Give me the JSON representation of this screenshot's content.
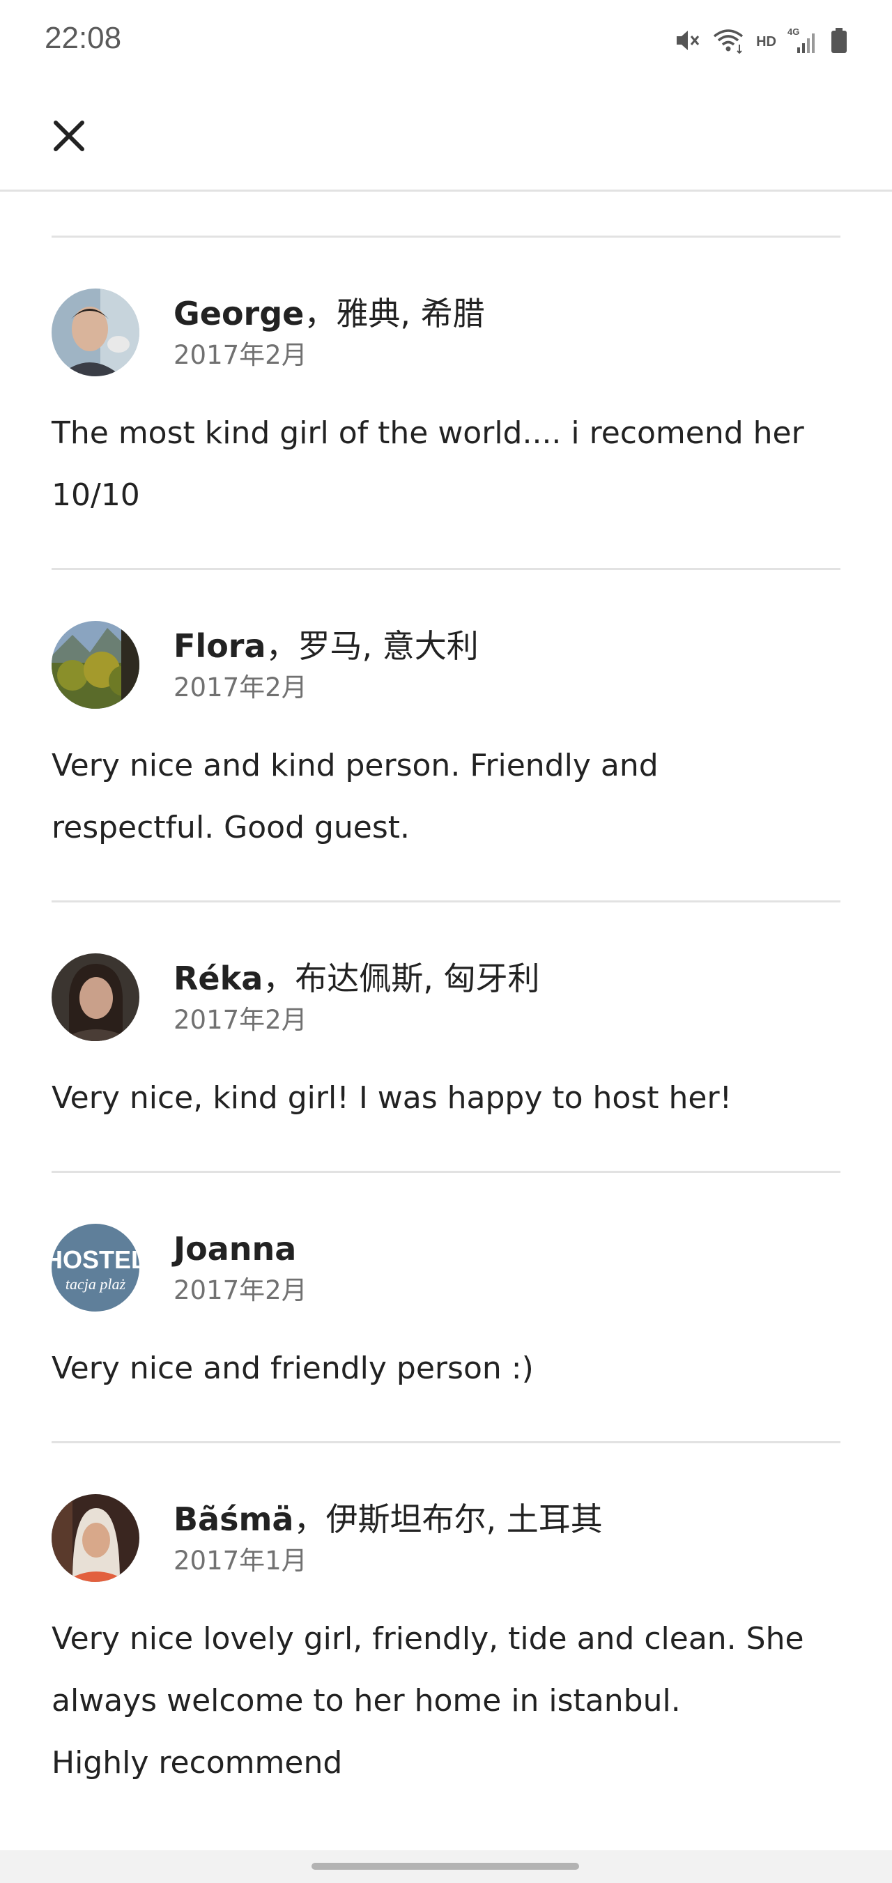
{
  "status_bar": {
    "time": "22:08",
    "network_label": "HD",
    "signal_label": "4G"
  },
  "header": {
    "close_icon": "close-icon"
  },
  "reviews": [
    {
      "name": "George",
      "location": "，雅典, 希腊",
      "date": "2017年2月",
      "text": "The most kind girl of the world.... i recomend her\n10/10"
    },
    {
      "name": "Flora",
      "location": "，罗马, 意大利",
      "date": "2017年2月",
      "text": "Very nice and kind person. Friendly and\nrespectful. Good guest."
    },
    {
      "name": "Réka",
      "location": "，布达佩斯, 匈牙利",
      "date": "2017年2月",
      "text": "Very nice, kind girl! I was happy to host her!"
    },
    {
      "name": "Joanna",
      "location": "",
      "date": "2017年2月",
      "avatar_text": "HOSTEL",
      "avatar_subtext": "tacja plaż",
      "text": "Very nice and friendly person :)"
    },
    {
      "name": "Bãśmä",
      "location": "，伊斯坦布尔, 土耳其",
      "date": "2017年1月",
      "text": "Very nice lovely girl, friendly, tide and clean. She\nalways welcome to her home in istanbul.\nHighly recommend"
    }
  ],
  "colors": {
    "text": "#222222",
    "secondary_text": "#717171",
    "divider": "#e2e2e2"
  }
}
